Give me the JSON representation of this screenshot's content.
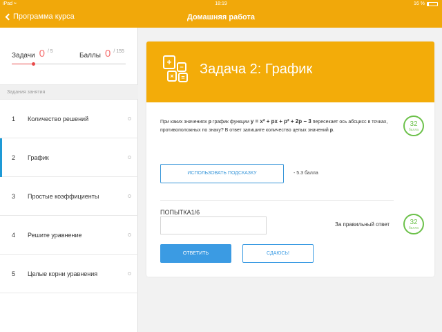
{
  "status_bar": {
    "device": "iPad",
    "time": "18:19",
    "battery": "16 %"
  },
  "nav": {
    "back_label": "Программа курса",
    "title": "Домашняя работа"
  },
  "stats": {
    "tasks_label": "Задачи",
    "tasks_value": "0",
    "tasks_total": "/ 5",
    "points_label": "Баллы",
    "points_value": "0",
    "points_total": "/ 155",
    "progress": 0.19
  },
  "sidebar": {
    "section_title": "Задания занятия",
    "items": [
      {
        "num": "1",
        "label": "Количество решений",
        "active": false
      },
      {
        "num": "2",
        "label": "График",
        "active": true
      },
      {
        "num": "3",
        "label": "Простые коэффициенты",
        "active": false
      },
      {
        "num": "4",
        "label": "Решите уравнение",
        "active": false
      },
      {
        "num": "5",
        "label": "Целые корни уравнения",
        "active": false
      }
    ]
  },
  "task": {
    "title": "Задача 2: График",
    "question_prefix": "При каких значениях",
    "param_p": "p",
    "question_mid": "график функции",
    "formula": "y = x² + px + p² + 2p − 3",
    "question_suffix": "пересекает ось абсцисс в точках, противоположных по знаку? В ответ запишите количество целых значений",
    "question_end": ".",
    "points_badge_value": "32",
    "points_badge_label": "балла",
    "hint_button": "ИСПОЛЬЗОВАТЬ ПОДСКАЗКУ",
    "hint_cost": "- 5.3 балла",
    "attempt_label": "ПОПЫТКА1/6",
    "answer_value": "",
    "correct_label": "За правильный ответ",
    "correct_badge_value": "32",
    "correct_badge_label": "балла",
    "answer_button": "ОТВЕТИТЬ",
    "giveup_button": "СДАЮСЬ!"
  },
  "colors": {
    "accent": "#f1a80a",
    "blue": "#3b9be3",
    "green": "#6cc14a",
    "red": "#f57070"
  }
}
